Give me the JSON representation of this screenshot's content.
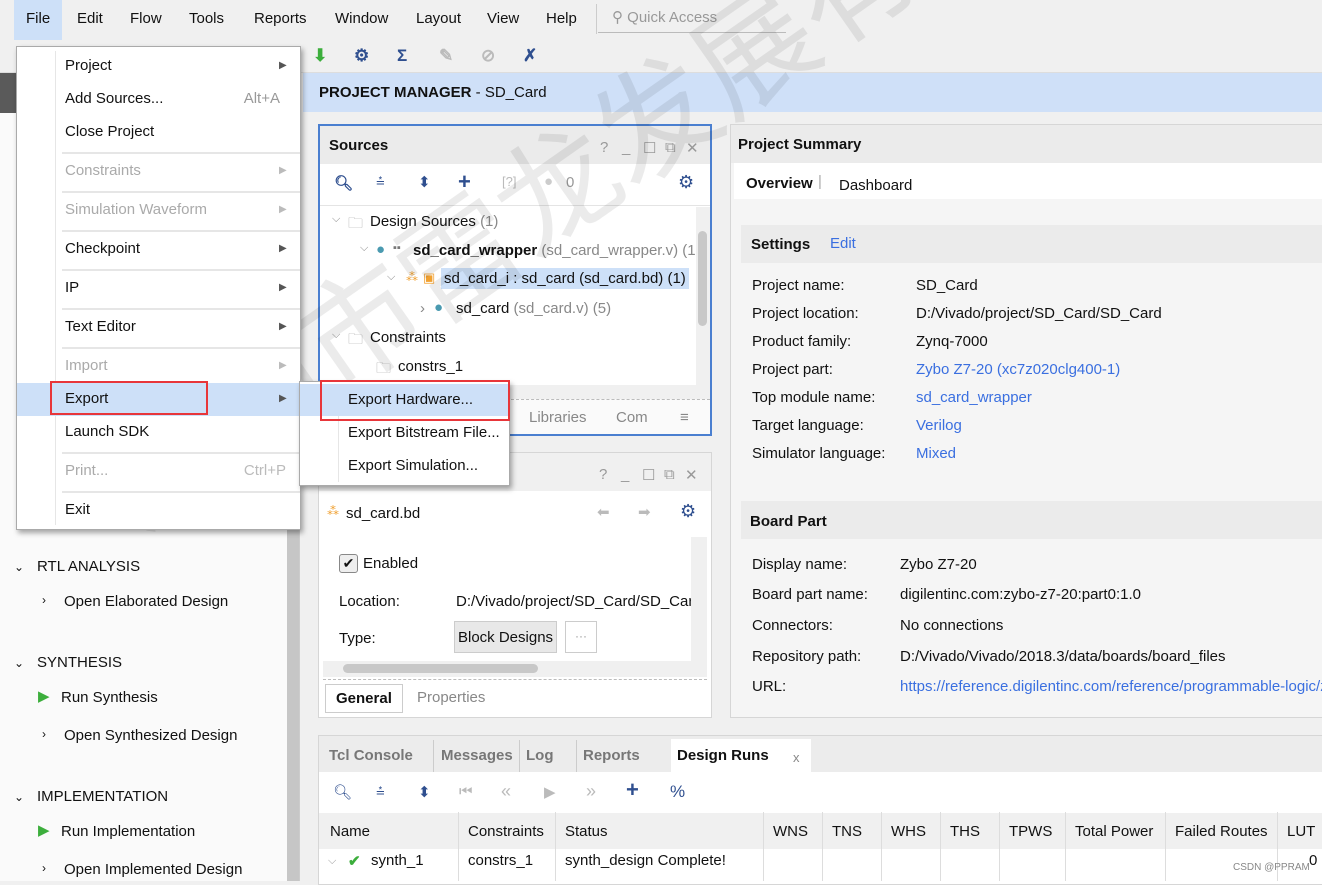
{
  "menubar": {
    "items": [
      "File",
      "Edit",
      "Flow",
      "Tools",
      "Reports",
      "Window",
      "Layout",
      "View",
      "Help"
    ],
    "quick_access_placeholder": "Quick Access"
  },
  "header": {
    "title_bold": "PROJECT MANAGER",
    "title_rest": " - SD_Card"
  },
  "file_menu": {
    "items": [
      {
        "label": "Project",
        "submenu": true
      },
      {
        "label": "Add Sources...",
        "shortcut": "Alt+A"
      },
      {
        "label": "Close Project"
      },
      {
        "label": "Constraints",
        "disabled": true,
        "submenu": true
      },
      {
        "label": "Simulation Waveform",
        "disabled": true,
        "submenu": true
      },
      {
        "label": "Checkpoint",
        "submenu": true
      },
      {
        "label": "IP",
        "submenu": true
      },
      {
        "label": "Text Editor",
        "submenu": true
      },
      {
        "label": "Import",
        "disabled": true,
        "submenu": true
      },
      {
        "label": "Export",
        "submenu": true,
        "highlighted": true
      },
      {
        "label": "Launch SDK"
      },
      {
        "label": "Print...",
        "shortcut": "Ctrl+P",
        "disabled": true
      },
      {
        "label": "Exit"
      }
    ]
  },
  "export_submenu": {
    "items": [
      "Export Hardware...",
      "Export Bitstream File...",
      "Export Simulation..."
    ],
    "highlighted": "Export Hardware..."
  },
  "flow_nav": {
    "sections": [
      {
        "title": "RTL ANALYSIS",
        "items": [
          {
            "label": "Open Elaborated Design",
            "icon": "chevron-right"
          }
        ]
      },
      {
        "title": "SYNTHESIS",
        "items": [
          {
            "label": "Run Synthesis",
            "icon": "play"
          },
          {
            "label": "Open Synthesized Design",
            "icon": "chevron-right"
          }
        ]
      },
      {
        "title": "IMPLEMENTATION",
        "items": [
          {
            "label": "Run Implementation",
            "icon": "play"
          },
          {
            "label": "Open Implemented Design",
            "icon": "chevron-right"
          }
        ]
      }
    ]
  },
  "sources": {
    "title": "Sources",
    "badge_count": "0",
    "tree": {
      "design_sources": "Design Sources",
      "design_sources_count": "(1)",
      "wrapper": "sd_card_wrapper",
      "wrapper_file": "(sd_card_wrapper.v) (1",
      "bd_inst": "sd_card_i : sd_card (sd_card.bd) (1)",
      "sd_card": "sd_card",
      "sd_card_file": "(sd_card.v) (5)",
      "constraints": "Constraints",
      "constrs": "constrs_1"
    },
    "tabs": [
      "Libraries",
      "Com"
    ]
  },
  "properties": {
    "file": "sd_card.bd",
    "enabled_label": "Enabled",
    "enabled": true,
    "location_label": "Location:",
    "location_value": "D:/Vivado/project/SD_Card/SD_Card",
    "type_label": "Type:",
    "type_value": "Block Designs",
    "more_button": "···",
    "tabs": [
      "General",
      "Properties"
    ]
  },
  "summary": {
    "title": "Project Summary",
    "tabs": [
      "Overview",
      "Dashboard"
    ],
    "settings_title": "Settings",
    "edit_link": "Edit",
    "settings": [
      {
        "label": "Project name:",
        "value": "SD_Card"
      },
      {
        "label": "Project location:",
        "value": "D:/Vivado/project/SD_Card/SD_Card"
      },
      {
        "label": "Product family:",
        "value": "Zynq-7000"
      },
      {
        "label": "Project part:",
        "value": "Zybo Z7-20 (xc7z020clg400-1)",
        "link": true
      },
      {
        "label": "Top module name:",
        "value": "sd_card_wrapper",
        "link": true
      },
      {
        "label": "Target language:",
        "value": "Verilog",
        "link": true
      },
      {
        "label": "Simulator language:",
        "value": "Mixed",
        "link": true
      }
    ],
    "board_title": "Board Part",
    "board": [
      {
        "label": "Display name:",
        "value": "Zybo Z7-20"
      },
      {
        "label": "Board part name:",
        "value": "digilentinc.com:zybo-z7-20:part0:1.0"
      },
      {
        "label": "Connectors:",
        "value": "No connections"
      },
      {
        "label": "Repository path:",
        "value": "D:/Vivado/Vivado/2018.3/data/boards/board_files"
      },
      {
        "label": "URL:",
        "value": "https://reference.digilentinc.com/reference/programmable-logic/zy",
        "link": true
      }
    ]
  },
  "bottom": {
    "tabs": [
      "Tcl Console",
      "Messages",
      "Log",
      "Reports",
      "Design Runs"
    ],
    "active_tab": "Design Runs",
    "close": "x",
    "columns": [
      "Name",
      "Constraints",
      "Status",
      "WNS",
      "TNS",
      "WHS",
      "THS",
      "TPWS",
      "Total Power",
      "Failed Routes",
      "LUT"
    ],
    "rows": [
      {
        "name": "synth_1",
        "constraints": "constrs_1",
        "status": "synth_design Complete!",
        "lut": "0"
      }
    ]
  },
  "watermark": "深圳市雷龙发展有限公司",
  "credit": "CSDN @PPRAM",
  "colors": {
    "accent": "#3a6fe0",
    "highlight": "#cde0f8",
    "red_box": "#e8363a",
    "focus_border": "#4a7fd0",
    "play_green": "#3cae3c"
  }
}
